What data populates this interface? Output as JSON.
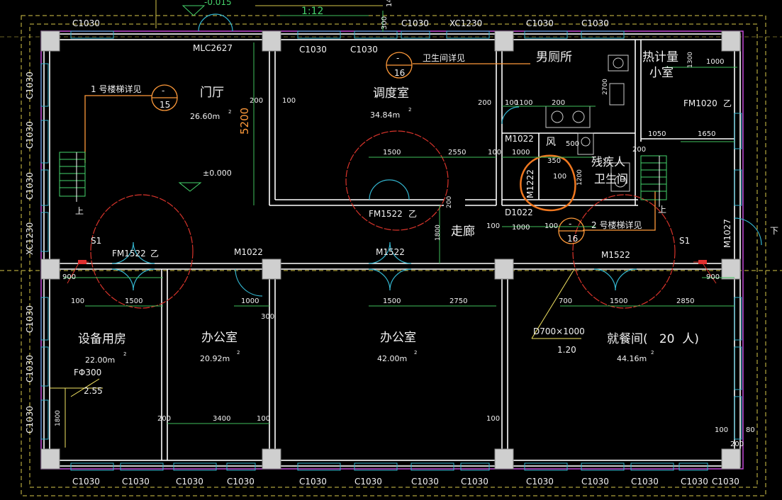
{
  "title_marks": {
    "top_level": "-0.015",
    "scale": "1:12",
    "num300": "300",
    "num14": "14"
  },
  "rooms": [
    {
      "name": "门厅",
      "area": "26.60m",
      "sup": "2"
    },
    {
      "name": "调度室",
      "area": "34.84m",
      "sup": "2"
    },
    {
      "name": "男厕所"
    },
    {
      "name": "热计量"
    },
    {
      "name": "小室"
    },
    {
      "name": "残疾人"
    },
    {
      "name": "卫生间"
    },
    {
      "name": "走廊"
    },
    {
      "name": "设备用房",
      "area": "22.00m",
      "sup": "2"
    },
    {
      "name": "办公室",
      "area": "20.92m",
      "sup": "2"
    },
    {
      "name": "办公室",
      "area": "42.00m",
      "sup": "2"
    },
    {
      "name": "就餐间(   20  人)",
      "area": "44.16m",
      "sup": "2"
    },
    {
      "name": "风"
    }
  ],
  "windows_top": [
    "C1030",
    "MLC2627",
    "C1030",
    "C1030",
    "C1030",
    "XC1230",
    "C1030",
    "C1030"
  ],
  "windows_bottom": [
    "C1030",
    "C1030",
    "C1030",
    "C1030",
    "C1030",
    "C1030",
    "C1030",
    "C1030",
    "C1030",
    "C1030",
    "C1030",
    "C1030",
    "C1030",
    "C1030"
  ],
  "windows_left": [
    "C1030",
    "C1030",
    "C1030",
    "XC1230",
    "C1030",
    "C1030",
    "C1030"
  ],
  "doors": [
    "FM1522",
    "乙",
    "M1022",
    "M1522",
    "M1522",
    "FM1522",
    "乙",
    "M1022",
    "D1022",
    "FM1020",
    "乙",
    "M1027",
    "M1222",
    "S1",
    "S1"
  ],
  "details": [
    {
      "text": "1 号楼梯详见",
      "num": "15",
      "dash": "-"
    },
    {
      "text": "卫生间详见",
      "num": "16",
      "dash": "-"
    },
    {
      "text": "2 号楼梯详见",
      "num": "16",
      "dash": "-"
    }
  ],
  "dims": [
    "5200",
    "200",
    "100",
    "200",
    "100",
    "1100",
    "200",
    "1000",
    "100",
    "1500",
    "2550",
    "100",
    "1000",
    "350",
    "100",
    "1200",
    "1050",
    "1650",
    "1300",
    "1000",
    "2700",
    "500",
    "200",
    "1500",
    "100",
    "1800",
    "200",
    "100",
    "1000",
    "100",
    "900",
    "900",
    "1500",
    "1000",
    "1500",
    "2750",
    "700",
    "1500",
    "2850",
    "300",
    "200",
    "3400",
    "100",
    "100",
    "100",
    "100",
    "80",
    "200",
    "1800",
    "1000",
    "1300",
    "200",
    "100"
  ],
  "levels": {
    "main": "±0.000",
    "sill": "1.20",
    "fd": "FΦ300",
    "fd_level": "2.55"
  },
  "duct": "D700×1000",
  "stairs": [
    "上",
    "上"
  ],
  "misc": {
    "right_edge": "下"
  },
  "colors": {
    "wall": "#ffffff",
    "dim": "#3fc15b",
    "window": "#33b5cf",
    "axis": "#c248d6",
    "revision": "#d9342b",
    "highlight": "#f07820"
  }
}
